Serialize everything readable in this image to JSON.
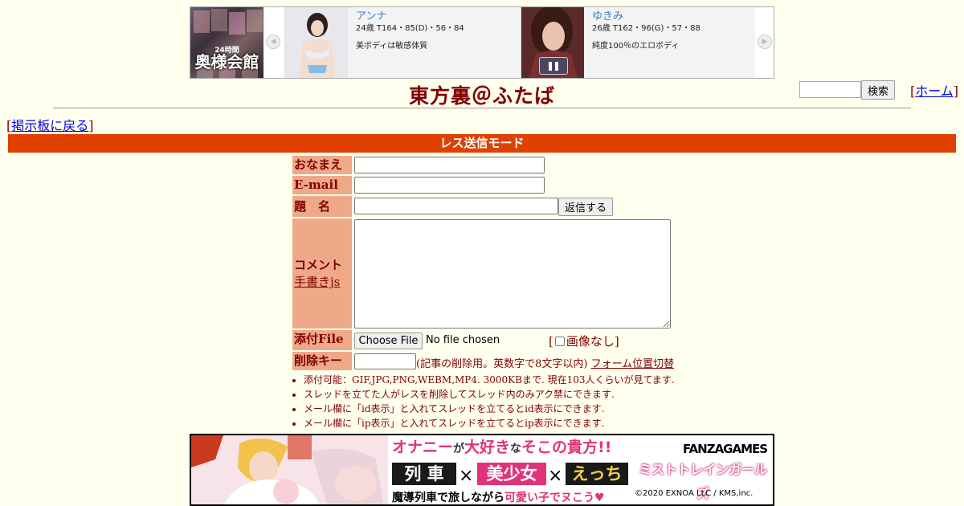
{
  "banner": {
    "logo_sub": "24時間",
    "logo_main": "奥様会館",
    "cards": [
      {
        "name": "アンナ",
        "spec": "24歳 T164・85(D)・56・84",
        "desc": "美ボディは敏感体質"
      },
      {
        "name": "ゆきみ",
        "spec": "26歳 T162・96(G)・57・88",
        "desc": "純度100％のエロボディ"
      }
    ],
    "prev_icon": "chevron-left-icon",
    "next_icon": "chevron-right-icon",
    "pause_icon": "pause-icon"
  },
  "header": {
    "title": "東方裏＠ふたば",
    "search_button": "検索",
    "home_link": "ホーム",
    "back_link": "掲示板に戻る",
    "bracket_open": "[",
    "bracket_close": "]"
  },
  "mode_bar": "レス送信モード",
  "form": {
    "name_label": "おなまえ",
    "email_label": "E-mail",
    "subject_label": "題　名",
    "submit_button": "返信する",
    "comment_label": "コメント",
    "handwrite_link": "手書きjs",
    "file_label": "添付File",
    "choose_file": "Choose File",
    "no_file": "No file chosen",
    "no_image_label": "画像なし",
    "delkey_label": "削除キー",
    "delkey_note": "(記事の削除用。英数字で8文字以内)",
    "form_position_link": "フォーム位置切替"
  },
  "notes": [
    "添付可能：GIF,JPG,PNG,WEBM,MP4. 3000KBまで. 現在103人くらいが見てます.",
    "スレッドを立てた人がレスを削除してスレッド内のみアク禁にできます.",
    "メール欄に「id表示」と入れてスレッドを立てるとid表示にできます.",
    "メール欄に「ip表示」と入れてスレッドを立てるとip表示にできます."
  ],
  "bottom_ad": {
    "headline_1": "オナニー",
    "headline_2": "が",
    "headline_3": "大好き",
    "headline_4": "な",
    "headline_5": "そこの貴方!!",
    "word_1": "列 車",
    "word_2": "美少女",
    "word_3": "えっち",
    "times": "×",
    "tagline_1": "魔導列車で旅しながら",
    "tagline_2": "可愛い子でヌこう♥",
    "brand": "FANZAGAMES",
    "game_title": "ミストトレインガールズ",
    "copyright": "©2020 EXNOA LLC / KMS,inc."
  },
  "colors": {
    "background": "#ffffee",
    "text": "#800000",
    "mode_bar": "#e04000",
    "label_bg": "#eeaa88",
    "link": "#0000ee"
  }
}
